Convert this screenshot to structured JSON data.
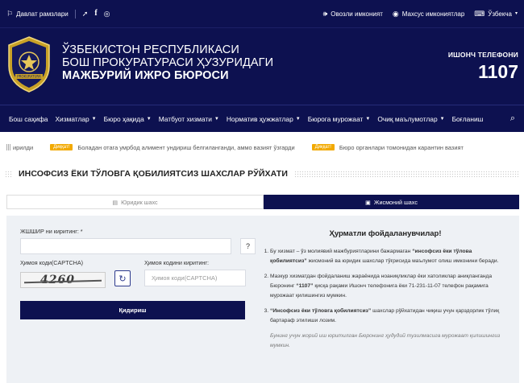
{
  "topbar": {
    "state_symbols": "Давлат рамзлари",
    "audio_label": "Овозли имконият",
    "special_label": "Махсус имкониятлар",
    "language": "Ўзбекча"
  },
  "header": {
    "org_line1": "ЎЗБЕКИСТОН РЕСПУБЛИКАСИ",
    "org_line2": "БОШ ПРОКУРАТУРАСИ ҲУЗУРИДАГИ",
    "org_line3": "МАЖБУРИЙ ИЖРО БЮРОСИ",
    "trust_label": "ИШОНЧ ТЕЛЕФОНИ",
    "trust_number": "1107",
    "emblem_text": "PROKURATURA"
  },
  "nav": {
    "items": [
      {
        "label": "Бош саҳифа",
        "has_dropdown": false
      },
      {
        "label": "Хизматлар",
        "has_dropdown": true
      },
      {
        "label": "Бюро ҳақида",
        "has_dropdown": true
      },
      {
        "label": "Матбуот хизмати",
        "has_dropdown": true
      },
      {
        "label": "Норматив ҳужжатлар",
        "has_dropdown": true
      },
      {
        "label": "Бюрога мурожаат",
        "has_dropdown": true
      },
      {
        "label": "Очиқ маълумотлар",
        "has_dropdown": true
      },
      {
        "label": "Боғланиш",
        "has_dropdown": false
      }
    ]
  },
  "ticker": {
    "item0": "ирилди",
    "item1_badge": "Диққат!",
    "item1": "Боладан отага умрбод алимент ундириш белгиланганди, аммо вазият ўзгарди",
    "item2_badge": "Диққат!",
    "item2": "Бюро органлари томонидан карантин вазият"
  },
  "section_title": "ИНСОФСИЗ ЁКИ ТЎЛОВГА ҚОБИЛИЯТСИЗ ШАХСЛАР РЎЙХАТИ",
  "tabs": {
    "legal": "Юридик шахс",
    "individual": "Жисмоний шахс",
    "active": "individual"
  },
  "form": {
    "pinfl_label": "ЖШШИР ни киритинг: *",
    "pinfl_value": "",
    "help_button": "?",
    "captcha_label": "Ҳимоя коди(CAPTCHA)",
    "captcha_text": "4260",
    "captcha_input_label": "Ҳимоя кодини киритинг:",
    "captcha_placeholder": "Ҳимоя коди(CAPTCHA)",
    "submit": "Қидириш"
  },
  "info": {
    "title": "Ҳурматли фойдаланувчилар!",
    "item1_pre": "Бу хизмат – ўз молиявий мажбуриятларини бажармаган ",
    "item1_bold": "“инсофсиз ёки тўлова қобилиятсиз”",
    "item1_post": " жисмоний ва юридик шахслар тўғрисида маълумот олиш имконини беради.",
    "item2_pre": "Мазкур хизматдан фойдаланиш жараёнида ноаниқликлар ёки хатоликлар аниқланганда Бюронинг ",
    "item2_bold": "“1107”",
    "item2_post": " қисқа рақами Ишонч телефонига ёки 71-231-11-07 телефон рақамига мурожаат қилишингиз мумкин.",
    "item3_bold": "“Инсофсиз ёки тўловга қобилиятсиз”",
    "item3_post": " шахслар рўйхатидан чиқиш учун қарздорлик тўлиқ бартараф этилиши лозим.",
    "note": "Бунинг учун жорий иш юритилган Бюронинг ҳудудий тузилмасига мурожаат қилишингиз мумкин."
  },
  "colors": {
    "navy": "#0d1150",
    "badge": "#f2a900",
    "panel": "#eef1f5"
  }
}
